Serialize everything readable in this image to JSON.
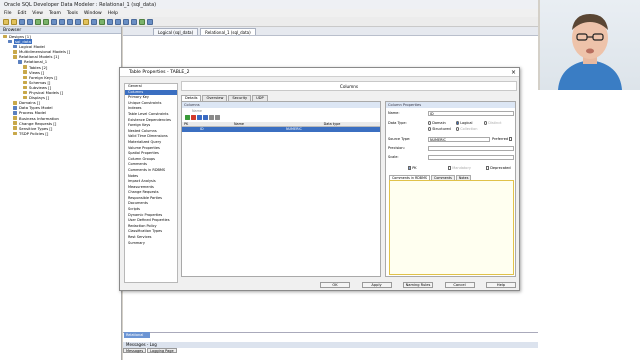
{
  "window": {
    "title": "Oracle SQL Developer Data Modeler : Relational_1 (sql_data)"
  },
  "menu": [
    "File",
    "Edit",
    "View",
    "Team",
    "Tools",
    "Window",
    "Help"
  ],
  "browser": {
    "title": "Browser",
    "tree": [
      {
        "label": "Designs [1]",
        "indent": 0,
        "icon": "folder-icon"
      },
      {
        "label": "sql_data",
        "indent": 1,
        "icon": "design-icon",
        "selected": true
      },
      {
        "label": "Logical Model",
        "indent": 2,
        "icon": "model-icon"
      },
      {
        "label": "Multidimensional Models []",
        "indent": 2,
        "icon": "folder-icon"
      },
      {
        "label": "Relational Models [1]",
        "indent": 2,
        "icon": "folder-icon"
      },
      {
        "label": "Relational_1",
        "indent": 3,
        "icon": "model-icon"
      },
      {
        "label": "Tables [2]",
        "indent": 4,
        "icon": "folder-icon"
      },
      {
        "label": "Views []",
        "indent": 4,
        "icon": "folder-icon"
      },
      {
        "label": "Foreign Keys []",
        "indent": 4,
        "icon": "folder-icon"
      },
      {
        "label": "Schemas []",
        "indent": 4,
        "icon": "folder-icon"
      },
      {
        "label": "Subviews []",
        "indent": 4,
        "icon": "folder-icon"
      },
      {
        "label": "Physical Models []",
        "indent": 4,
        "icon": "folder-icon"
      },
      {
        "label": "Displays []",
        "indent": 4,
        "icon": "folder-icon"
      },
      {
        "label": "Domains []",
        "indent": 2,
        "icon": "folder-icon"
      },
      {
        "label": "Data Types Model",
        "indent": 2,
        "icon": "model-icon"
      },
      {
        "label": "Process Model",
        "indent": 2,
        "icon": "model-icon"
      },
      {
        "label": "Business Information",
        "indent": 2,
        "icon": "folder-icon"
      },
      {
        "label": "Change Requests []",
        "indent": 2,
        "icon": "folder-icon"
      },
      {
        "label": "Sensitive Types []",
        "indent": 2,
        "icon": "folder-icon"
      },
      {
        "label": "TSDP Policies []",
        "indent": 2,
        "icon": "folder-icon"
      }
    ]
  },
  "doc_tabs": [
    "Logical (sql_data)",
    "Relational_1 (sql_data)"
  ],
  "dialog": {
    "title": "Table Properties - TABLE_2",
    "close": "×",
    "header": "Columns",
    "nav": [
      "General",
      "Columns",
      "Primary Key",
      "Unique Constraints",
      "Indexes",
      "Table Level Constraints",
      "Existence Dependencies",
      "Foreign Keys",
      "Nested Columns",
      "Valid Time Dimensions",
      "Materialized Query",
      "Volume Properties",
      "Spatial Properties",
      "Column Groups",
      "Comments",
      "Comments in RDBMS",
      "Notes",
      "Impact Analysis",
      "Measurements",
      "Change Requests",
      "Responsible Parties",
      "Documents",
      "Scripts",
      "Dynamic Properties",
      "User Defined Properties",
      "Redaction Policy",
      "Classification Types",
      "Rest Services",
      "Summary"
    ],
    "tabs": [
      "Details",
      "Overview",
      "Security",
      "UDP"
    ],
    "columns_label": "Columns",
    "filter_placeholder": "Name",
    "table_headers": [
      "PK",
      "Name",
      "Data type"
    ],
    "row": {
      "pk": "",
      "name": "ID",
      "type": "NUMERIC"
    },
    "props": {
      "label": "Column Properties",
      "name_label": "Name:",
      "name_value": "ID",
      "datatype_label": "Data Type:",
      "radio_domain": "Domain",
      "radio_logical": "Logical",
      "radio_distinct": "Distinct",
      "radio_structured": "Structured",
      "radio_collection": "Collection",
      "source_type_label": "Source Type:",
      "source_type_value": "NUMERIC",
      "preferred_label": "Preferred",
      "precision_label": "Precision:",
      "scale_label": "Scale:",
      "pk_label": "PK",
      "mandatory_label": "Mandatory",
      "deprecated_label": "Deprecated",
      "comment_tabs": [
        "Comments in RDBMS",
        "Comments",
        "Notes"
      ]
    },
    "buttons": [
      "OK",
      "Apply",
      "Naming Rules",
      "Cancel",
      "Help"
    ]
  },
  "bottom": {
    "relational_tab": "Relational",
    "log_title": "Messages - Log",
    "log_tabs": [
      "Messages",
      "Logging Page"
    ]
  }
}
